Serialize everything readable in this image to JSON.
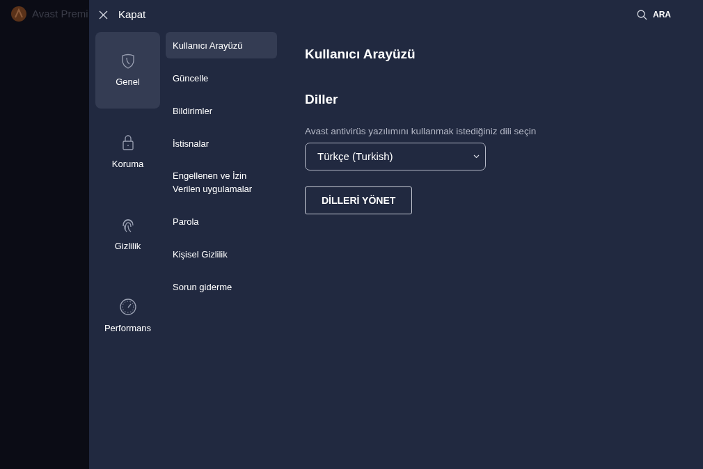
{
  "background_app": {
    "title": "Avast Premi"
  },
  "top_bar": {
    "close_label": "Kapat",
    "search_label": "ARA"
  },
  "categories": [
    {
      "kind": "shield",
      "label": "Genel",
      "selected": true
    },
    {
      "kind": "lock",
      "label": "Koruma",
      "selected": false
    },
    {
      "kind": "fingerprint",
      "label": "Gizlilik",
      "selected": false
    },
    {
      "kind": "gauge",
      "label": "Performans",
      "selected": false
    }
  ],
  "subnav": [
    {
      "label": "Kullanıcı Arayüzü",
      "selected": true
    },
    {
      "label": "Güncelle",
      "selected": false
    },
    {
      "label": "Bildirimler",
      "selected": false
    },
    {
      "label": "İstisnalar",
      "selected": false
    },
    {
      "label": "Engellenen ve İzin Verilen uygulamalar",
      "selected": false
    },
    {
      "label": "Parola",
      "selected": false
    },
    {
      "label": "Kişisel Gizlilik",
      "selected": false
    },
    {
      "label": "Sorun giderme",
      "selected": false
    }
  ],
  "content": {
    "title": "Kullanıcı Arayüzü",
    "section_title": "Diller",
    "description": "Avast antivirüs yazılımını kullanmak istediğiniz dili seçin",
    "language_select": {
      "value": "Türkçe (Turkish)"
    },
    "manage_button": "DİLLERİ YÖNET"
  }
}
